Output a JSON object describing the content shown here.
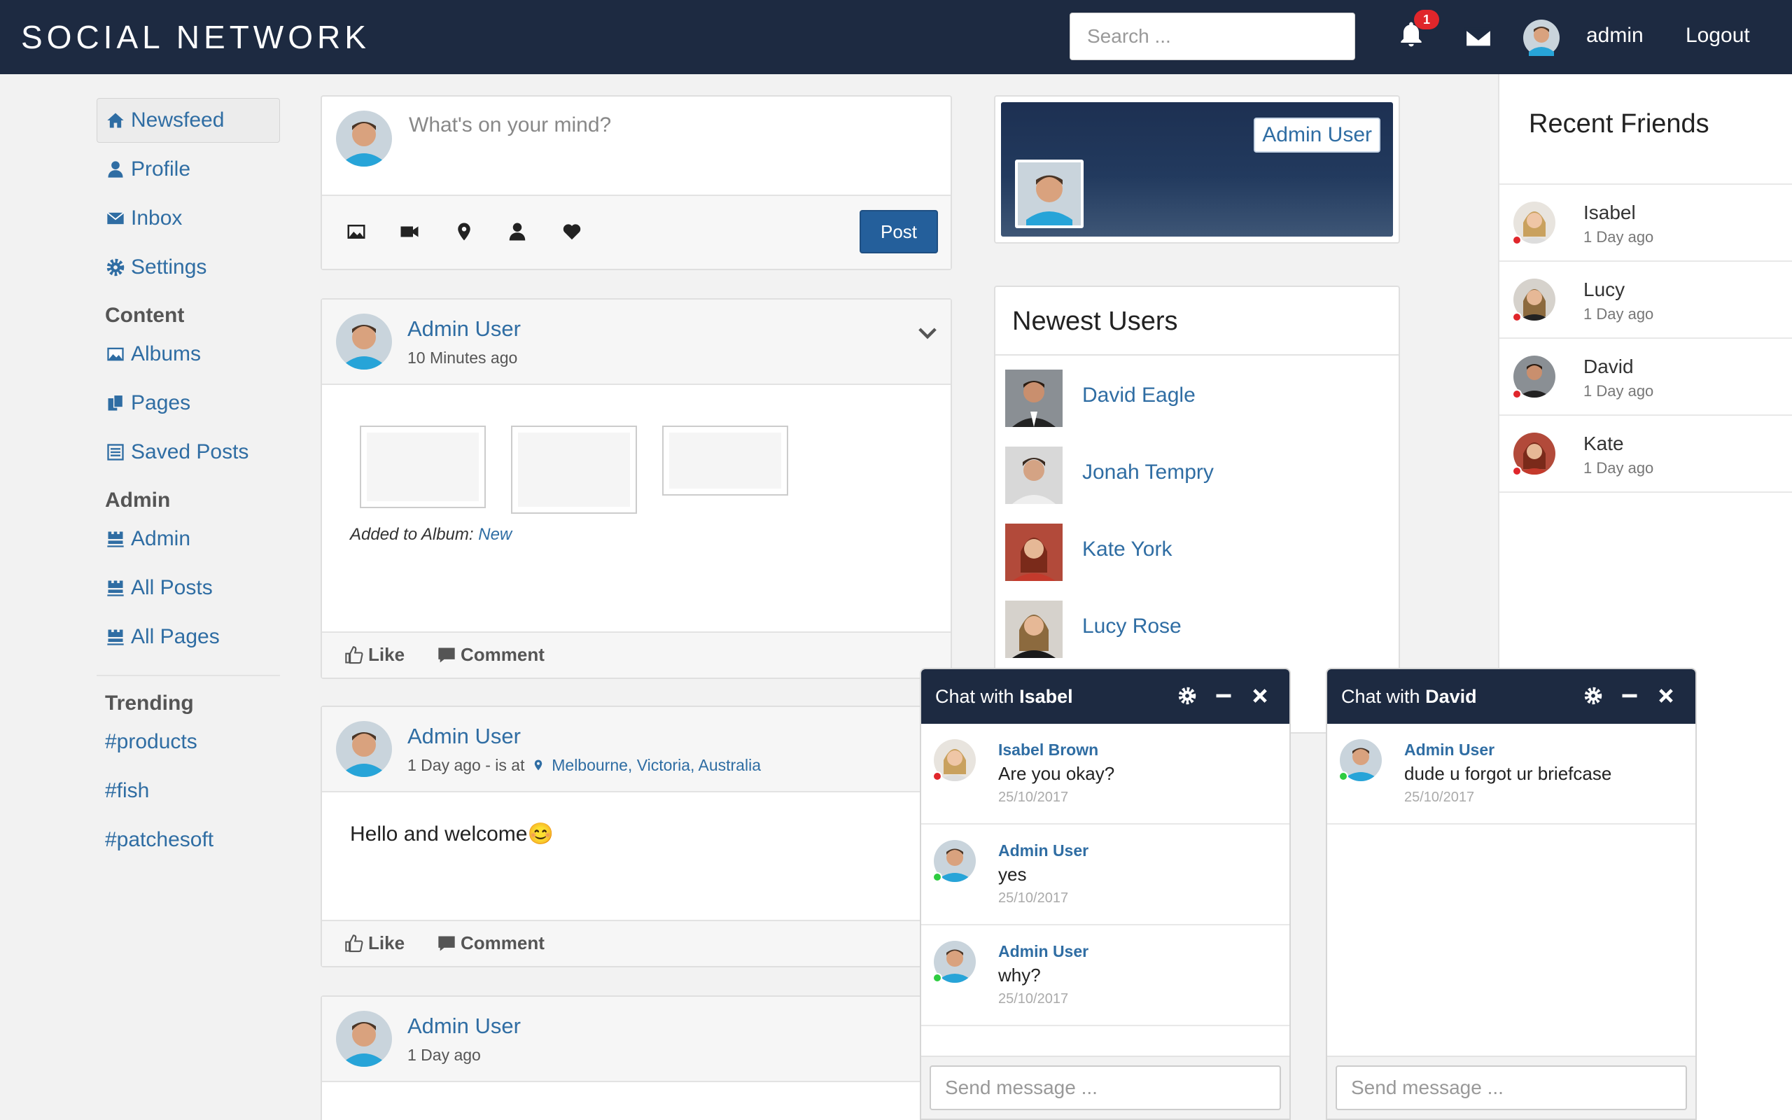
{
  "header": {
    "brand": "SOCIAL NETWORK",
    "search_placeholder": "Search ...",
    "notification_count": "1",
    "username": "admin",
    "logout": "Logout"
  },
  "sidebar": {
    "items": [
      {
        "label": "Newsfeed",
        "icon": "home-icon"
      },
      {
        "label": "Profile",
        "icon": "user-icon"
      },
      {
        "label": "Inbox",
        "icon": "envelope-icon"
      },
      {
        "label": "Settings",
        "icon": "gear-icon"
      }
    ],
    "content_heading": "Content",
    "content_items": [
      {
        "label": "Albums",
        "icon": "picture-icon"
      },
      {
        "label": "Pages",
        "icon": "pages-icon"
      },
      {
        "label": "Saved Posts",
        "icon": "list-icon"
      }
    ],
    "admin_heading": "Admin",
    "admin_items": [
      {
        "label": "Admin",
        "icon": "tower-icon"
      },
      {
        "label": "All Posts",
        "icon": "tower-icon"
      },
      {
        "label": "All Pages",
        "icon": "tower-icon"
      }
    ],
    "trending_heading": "Trending",
    "trending": [
      "#products",
      "#fish",
      "#patchesoft"
    ]
  },
  "composer": {
    "placeholder": "What's on your mind?",
    "post_label": "Post",
    "tools": [
      "picture-icon",
      "video-icon",
      "map-marker-icon",
      "user-icon",
      "heart-icon"
    ]
  },
  "posts": [
    {
      "author": "Admin User",
      "time": "10 Minutes ago",
      "album_prefix": "Added to Album:",
      "album_link": "New",
      "like": "Like",
      "comment": "Comment"
    },
    {
      "author": "Admin User",
      "time": "1 Day ago - is at",
      "location": "Melbourne, Victoria, Australia",
      "text": "Hello and welcome😊",
      "like": "Like",
      "comment": "Comment"
    },
    {
      "author": "Admin User",
      "time": "1 Day ago"
    }
  ],
  "profile_card": {
    "name": "Admin User"
  },
  "newest_users": {
    "title": "Newest Users",
    "users": [
      "David Eagle",
      "Jonah Tempry",
      "Kate York",
      "Lucy Rose"
    ]
  },
  "recent_friends": {
    "title": "Recent Friends",
    "friends": [
      {
        "name": "Isabel",
        "time": "1 Day ago"
      },
      {
        "name": "Lucy",
        "time": "1 Day ago"
      },
      {
        "name": "David",
        "time": "1 Day ago"
      },
      {
        "name": "Kate",
        "time": "1 Day ago"
      }
    ]
  },
  "chats": [
    {
      "title_prefix": "Chat with",
      "title_name": "Isabel",
      "input_placeholder": "Send message ...",
      "messages": [
        {
          "who": "Isabel Brown",
          "text": "Are you okay?",
          "date": "25/10/2017",
          "status": "offline"
        },
        {
          "who": "Admin User",
          "text": "yes",
          "date": "25/10/2017",
          "status": "online"
        },
        {
          "who": "Admin User",
          "text": "why?",
          "date": "25/10/2017",
          "status": "online"
        }
      ]
    },
    {
      "title_prefix": "Chat with",
      "title_name": "David",
      "input_placeholder": "Send message ...",
      "messages": [
        {
          "who": "Admin User",
          "text": "dude u forgot ur briefcase",
          "date": "25/10/2017",
          "status": "online"
        }
      ]
    }
  ],
  "colors": {
    "navbar": "#1d2a41",
    "link": "#2f6da3",
    "post_button": "#245f9b",
    "badge": "#e0262b",
    "online": "#2ecc40",
    "offline": "#e0262b"
  }
}
